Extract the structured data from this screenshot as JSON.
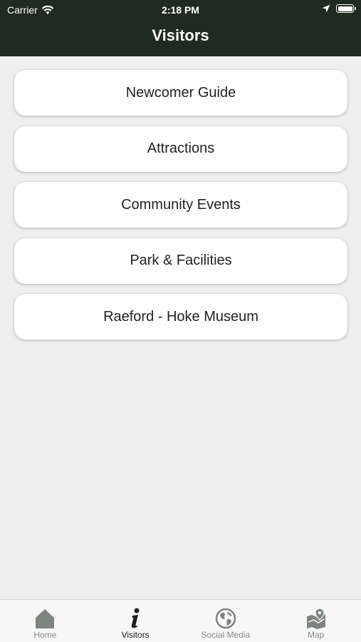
{
  "status_bar": {
    "carrier": "Carrier",
    "time": "2:18 PM"
  },
  "nav": {
    "title": "Visitors"
  },
  "menu": {
    "items": [
      {
        "label": "Newcomer Guide"
      },
      {
        "label": "Attractions"
      },
      {
        "label": "Community Events"
      },
      {
        "label": "Park & Facilities"
      },
      {
        "label": "Raeford - Hoke Museum"
      }
    ]
  },
  "tab_bar": {
    "tabs": [
      {
        "label": "Home",
        "icon": "home-icon",
        "active": false
      },
      {
        "label": "Visitors",
        "icon": "info-icon",
        "active": true
      },
      {
        "label": "Social Media",
        "icon": "globe-icon",
        "active": false
      },
      {
        "label": "Map",
        "icon": "map-icon",
        "active": false
      }
    ]
  },
  "colors": {
    "header_bg": "#1f2a20",
    "page_bg": "#efefef",
    "tab_icon_inactive": "#7d857e",
    "tab_icon_active": "#1e1e1e"
  }
}
